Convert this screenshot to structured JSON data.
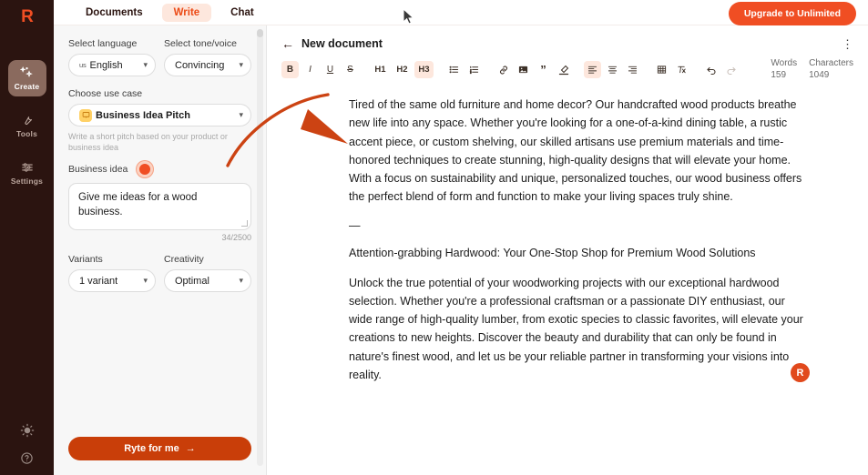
{
  "brand": {
    "logo_letter": "R",
    "accent": "#f04e23",
    "rail_bg": "#2b1410",
    "cta_color": "#c93e09"
  },
  "rail": {
    "items": [
      {
        "label": "Create",
        "icon": "sparkles-icon",
        "active": true
      },
      {
        "label": "Tools",
        "icon": "wrench-icon",
        "active": false
      },
      {
        "label": "Settings",
        "icon": "sliders-icon",
        "active": false
      }
    ],
    "bottom": [
      {
        "icon": "sun-icon",
        "name": "theme-toggle"
      },
      {
        "icon": "help-icon",
        "name": "help-button"
      }
    ]
  },
  "topbar": {
    "tabs": [
      {
        "label": "Documents",
        "active": false
      },
      {
        "label": "Write",
        "active": true
      },
      {
        "label": "Chat",
        "active": false
      }
    ],
    "upgrade_label": "Upgrade to Unlimited"
  },
  "panel": {
    "language": {
      "label": "Select language",
      "flag": "us",
      "value": "English"
    },
    "tone": {
      "label": "Select tone/voice",
      "value": "Convincing"
    },
    "use_case": {
      "label": "Choose use case",
      "value": "Business Idea Pitch",
      "hint": "Write a short pitch based on your product or business idea"
    },
    "business_idea": {
      "label": "Business idea",
      "value": "Give me ideas for a wood business.",
      "counter": "34/2500"
    },
    "variants": {
      "label": "Variants",
      "value": "1 variant"
    },
    "creativity": {
      "label": "Creativity",
      "value": "Optimal"
    },
    "cta_label": "Ryte for me",
    "cta_arrow": "→"
  },
  "editor": {
    "back_icon": "back-arrow-icon",
    "title": "New document",
    "menu_icon": "kebab-menu-icon",
    "toolbar": [
      {
        "name": "bold-button",
        "glyph": "B",
        "style": "bold",
        "active": true
      },
      {
        "name": "italic-button",
        "glyph": "I",
        "style": "italic",
        "active": false
      },
      {
        "name": "underline-button",
        "glyph": "U",
        "style": "underline",
        "active": false
      },
      {
        "name": "strikethrough-button",
        "glyph": "S",
        "style": "strike",
        "active": false
      },
      {
        "name": "heading-1-button",
        "glyph": "H1",
        "style": "h",
        "active": false
      },
      {
        "name": "heading-2-button",
        "glyph": "H2",
        "style": "h",
        "active": false
      },
      {
        "name": "heading-3-button",
        "glyph": "H3",
        "style": "h",
        "active": true
      },
      {
        "name": "bullet-list-button",
        "glyph": "☰",
        "style": "icon",
        "active": false
      },
      {
        "name": "numbered-list-button",
        "glyph": "☲",
        "style": "icon",
        "active": false
      },
      {
        "name": "link-button",
        "glyph": "∞",
        "style": "icon",
        "active": false
      },
      {
        "name": "image-button",
        "glyph": "▣",
        "style": "icon",
        "active": false
      },
      {
        "name": "quote-button",
        "glyph": "”",
        "style": "icon",
        "active": false
      },
      {
        "name": "highlighter-button",
        "glyph": "✐",
        "style": "icon",
        "active": false
      },
      {
        "name": "align-left-button",
        "glyph": "≡",
        "style": "icon",
        "active": true
      },
      {
        "name": "align-center-button",
        "glyph": "≡",
        "style": "icon",
        "active": false
      },
      {
        "name": "align-right-button",
        "glyph": "≡",
        "style": "icon",
        "active": false
      },
      {
        "name": "table-button",
        "glyph": "⊞",
        "style": "icon",
        "active": false
      },
      {
        "name": "clear-format-button",
        "glyph": "✗",
        "style": "icon",
        "active": false
      },
      {
        "name": "undo-button",
        "glyph": "↶",
        "style": "icon",
        "active": false
      },
      {
        "name": "redo-button",
        "glyph": "↷",
        "style": "dim",
        "active": false
      }
    ],
    "stats": {
      "words_label": "Words",
      "words_value": "159",
      "characters_label": "Characters",
      "characters_value": "1049"
    },
    "content": {
      "paragraph_1": "Tired of the same old furniture and home decor? Our handcrafted wood products breathe new life into any space. Whether you're looking for a one-of-a-kind dining table, a rustic accent piece, or custom shelving, our skilled artisans use premium materials and time-honored techniques to create stunning, high-quality designs that will elevate your home. With a focus on sustainability and unique, personalized touches, our wood business offers the perfect blend of form and function to make your living spaces truly shine.",
      "divider": "—",
      "heading_1": "Attention-grabbing Hardwood: Your One-Stop Shop for Premium Wood Solutions",
      "paragraph_2": "Unlock the true potential of your woodworking projects with our exceptional hardwood selection. Whether you're a professional craftsman or a passionate DIY enthusiast, our wide range of high-quality lumber, from exotic species to classic favorites, will elevate your creations to new heights. Discover the beauty and durability that can only be found in nature's finest wood, and let us be your reliable partner in transforming your visions into reality."
    },
    "floating_badge_letter": "R"
  }
}
